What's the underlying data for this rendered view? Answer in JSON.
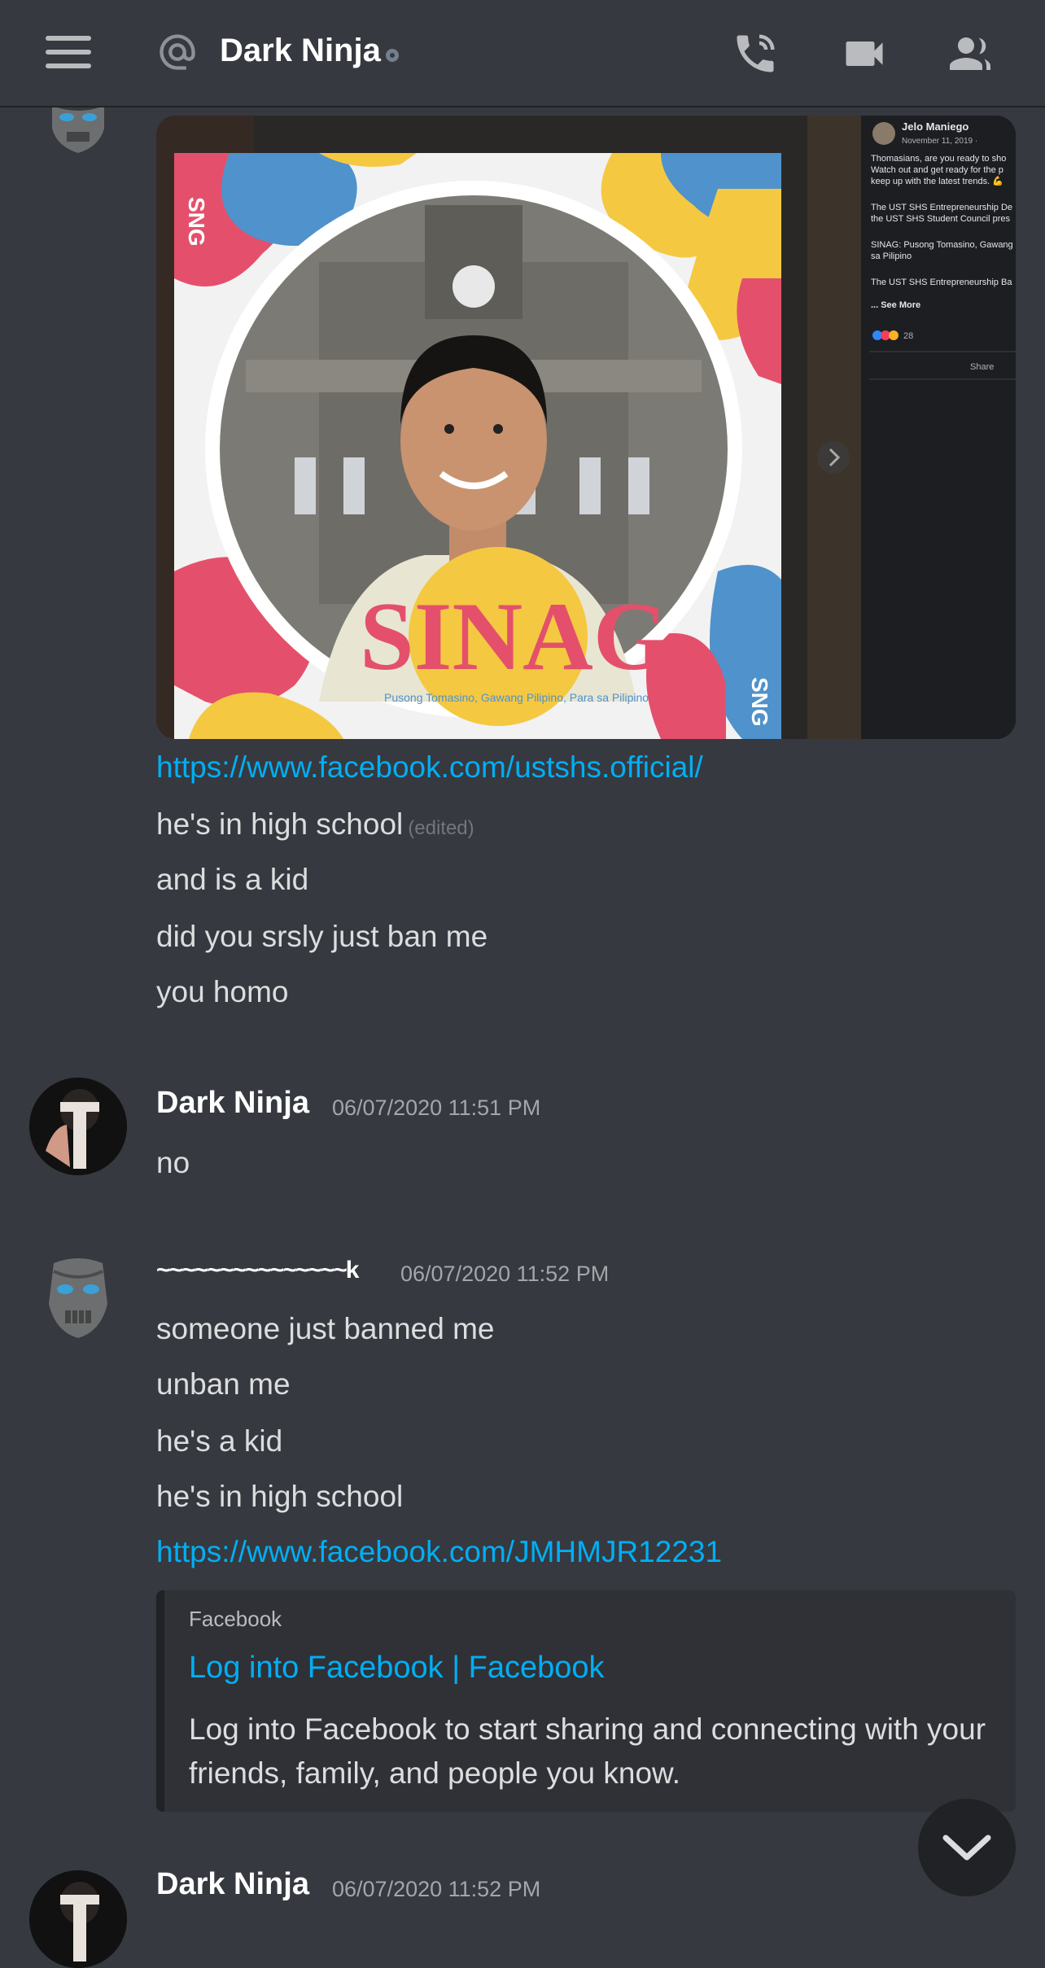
{
  "header": {
    "title": "Dark Ninja",
    "icons": [
      "menu-icon",
      "at-icon",
      "status-offline-icon",
      "call-icon",
      "video-icon",
      "members-icon"
    ]
  },
  "embed_image": {
    "fb_name": "Jelo Maniego",
    "fb_date": "November 11, 2019 · ",
    "fb_lines": [
      "Thomasians, are you ready to sho",
      "Watch out and get ready for the p",
      "keep up with the latest trends. 💪",
      "",
      "The UST SHS Entrepreneurship De",
      "the UST SHS Student Council pres",
      "",
      "SINAG: Pusong Tomasino, Gawang",
      "sa Pilipino",
      "",
      "The UST SHS Entrepreneurship Ba"
    ],
    "see_more": "... See More",
    "reactions": "28",
    "share": "Share",
    "poster_text": "SINAG",
    "poster_sub": "Pusong Tomasino, Gawang Pilipino, Para sa Pilipino"
  },
  "messages": [
    {
      "text": "https://www.facebook.com/ustshs.official/"
    },
    {
      "text": "he's in high school",
      "edited": "(edited)"
    },
    {
      "text": "and is a kid"
    },
    {
      "text": "did you srsly just ban me"
    },
    {
      "text": "you homo"
    }
  ],
  "group2": {
    "username": "Dark Ninja",
    "timestamp": "06/07/2020 11:51 PM",
    "messages": [
      {
        "text": "no"
      }
    ]
  },
  "group3": {
    "username": "~~~~~~~~~~~~~~~k",
    "timestamp": "06/07/2020 11:52 PM",
    "messages": [
      {
        "text": "someone just banned me"
      },
      {
        "text": "unban me"
      },
      {
        "text": "he's a kid"
      },
      {
        "text": "he's in high school"
      },
      {
        "text": "https://www.facebook.com/JMHMJR12231"
      }
    ],
    "embed": {
      "provider": "Facebook",
      "title": "Log into Facebook | Facebook",
      "description": "Log into Facebook to start sharing and connecting with your friends, family, and people you know."
    }
  },
  "group4": {
    "username": "Dark Ninja",
    "timestamp": "06/07/2020 11:52 PM"
  },
  "colors": {
    "background": "#36393f",
    "link": "#00aff4",
    "embed_bg": "#2f3136"
  }
}
